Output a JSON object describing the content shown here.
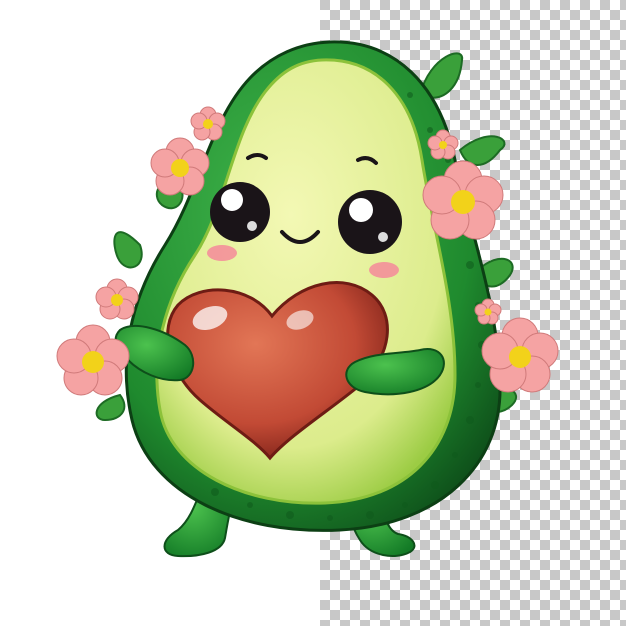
{
  "image": {
    "subject": "avatar",
    "colors": {
      "background": "#ffffff",
      "checker_light": "#ffffff",
      "checker_dark": "#c8c8c8",
      "skin": "#1f8a2e",
      "skin_dark": "#10561c",
      "flesh": "#e8f29a",
      "flesh_edge": "#a8d24a",
      "heart": "#c8503a",
      "heart_dark": "#8e2a20",
      "petal": "#f5a3a3",
      "flower_center": "#f2d21a",
      "leaf": "#3aa03a",
      "cheek": "#f58a9a",
      "eye": "#1a1418"
    }
  }
}
